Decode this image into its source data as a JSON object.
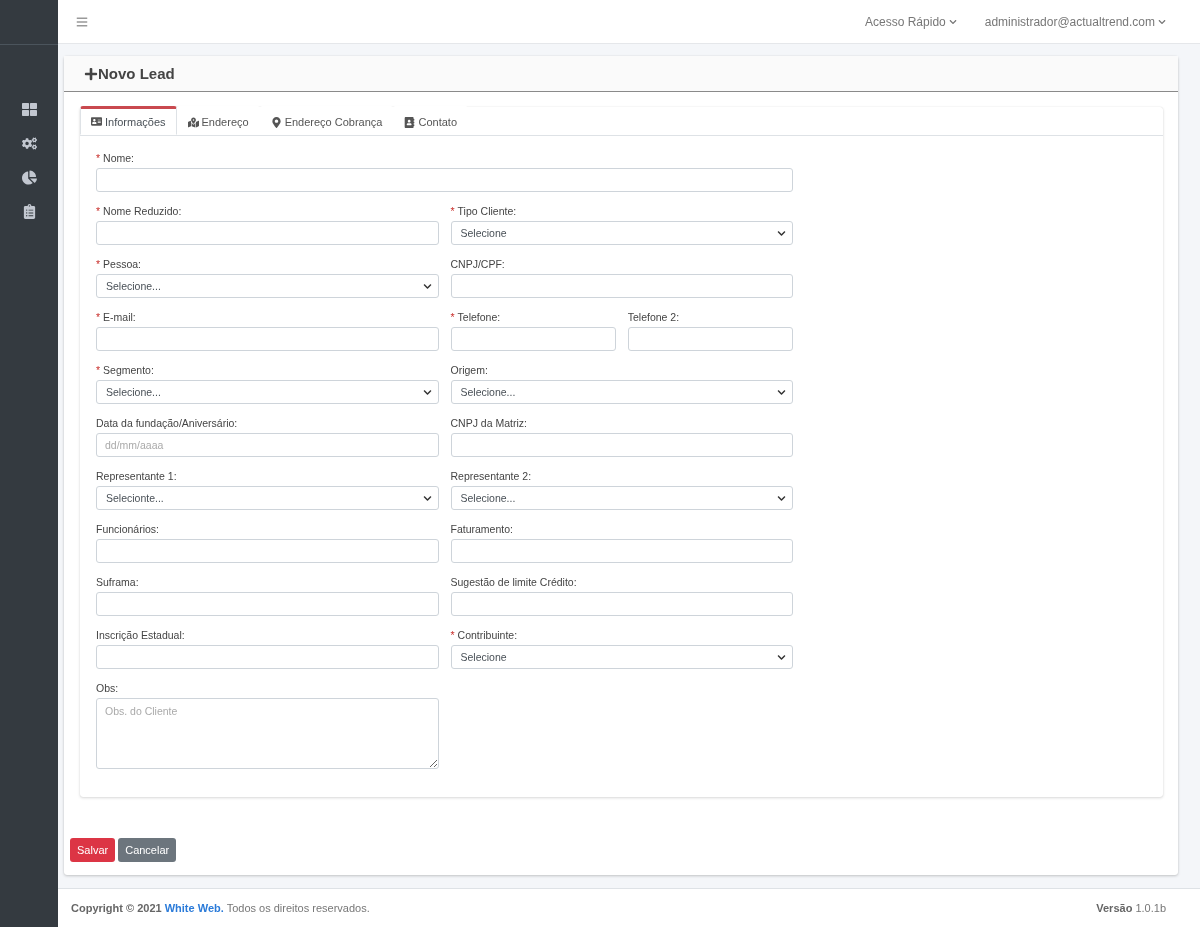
{
  "navbar": {
    "quick_access": "Acesso Rápido",
    "user": "administrador@actualtrend.com"
  },
  "sidebar": {
    "items": [
      {
        "kind": "dashboard"
      },
      {
        "kind": "settings"
      },
      {
        "kind": "reports"
      },
      {
        "kind": "tasks"
      }
    ]
  },
  "page_title": "Novo Lead",
  "required_mark": "*",
  "tabs": [
    {
      "label": "Informações",
      "kind": "card",
      "selected": true
    },
    {
      "label": "Endereço",
      "kind": "map",
      "selected": false
    },
    {
      "label": "Endereço Cobrança",
      "kind": "pin",
      "selected": false
    },
    {
      "label": "Contato",
      "kind": "contact",
      "selected": false
    }
  ],
  "rows": [
    {
      "fields": [
        {
          "label": "Nome:",
          "required": true,
          "kind": "text"
        }
      ]
    },
    {
      "fields": [
        {
          "label": "Nome Reduzido:",
          "required": true,
          "kind": "text"
        },
        {
          "label": "Tipo Cliente:",
          "required": true,
          "kind": "select",
          "value": "Selecione"
        }
      ]
    },
    {
      "fields": [
        {
          "label": "Pessoa:",
          "required": true,
          "kind": "select",
          "value": "Selecione..."
        },
        {
          "label": "CNPJ/CPF:",
          "required": false,
          "kind": "text"
        }
      ]
    },
    {
      "fields": [
        {
          "label": "E-mail:",
          "required": true,
          "kind": "text"
        },
        {
          "label": "Telefone:",
          "required": true,
          "kind": "text"
        },
        {
          "label": "Telefone 2:",
          "required": false,
          "kind": "text"
        }
      ]
    },
    {
      "fields": [
        {
          "label": "Segmento:",
          "required": true,
          "kind": "select",
          "value": "Selecione..."
        },
        {
          "label": "Origem:",
          "required": false,
          "kind": "select",
          "value": "Selecione..."
        }
      ]
    },
    {
      "fields": [
        {
          "label": "Data da fundação/Aniversário:",
          "required": false,
          "kind": "text",
          "placeholder": "dd/mm/aaaa"
        },
        {
          "label": "CNPJ da Matriz:",
          "required": false,
          "kind": "text"
        }
      ]
    },
    {
      "fields": [
        {
          "label": "Representante 1:",
          "required": false,
          "kind": "select",
          "value": "Selecionte..."
        },
        {
          "label": "Representante 2:",
          "required": false,
          "kind": "select",
          "value": "Selecione..."
        }
      ]
    },
    {
      "fields": [
        {
          "label": "Funcionários:",
          "required": false,
          "kind": "text"
        },
        {
          "label": "Faturamento:",
          "required": false,
          "kind": "text"
        }
      ]
    },
    {
      "fields": [
        {
          "label": "Suframa:",
          "required": false,
          "kind": "text"
        },
        {
          "label": "Sugestão de limite Crédito:",
          "required": false,
          "kind": "text"
        }
      ]
    },
    {
      "fields": [
        {
          "label": "Inscrição Estadual:",
          "required": false,
          "kind": "text"
        },
        {
          "label": "Contribuinte:",
          "required": true,
          "kind": "select",
          "value": "Selecione"
        }
      ]
    },
    {
      "fields": [
        {
          "label": "Obs:",
          "required": false,
          "kind": "textarea",
          "placeholder": "Obs. do Cliente"
        }
      ]
    }
  ],
  "buttons": [
    {
      "label": "Salvar",
      "kind": "primary"
    },
    {
      "label": "Cancelar",
      "kind": "secondary"
    }
  ],
  "footer": {
    "prefix": "Copyright © 2021",
    "link": "White Web.",
    "suffix": "Todos os direitos reservados.",
    "version": "**Versão** 1.0.1b"
  }
}
